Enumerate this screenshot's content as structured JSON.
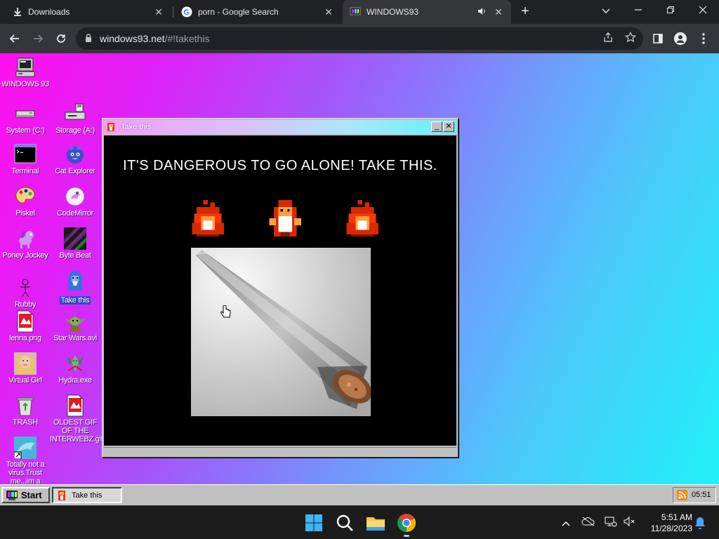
{
  "browser": {
    "tabs": [
      {
        "title": "Downloads",
        "icon": "download-icon",
        "active": false
      },
      {
        "title": "porn - Google Search",
        "icon": "google-icon",
        "active": false
      },
      {
        "title": "WINDOWS93",
        "icon": "windows93-icon",
        "active": true,
        "audio": true
      }
    ],
    "url_host": "windows93.net",
    "url_path": "/#!takethis"
  },
  "desktop": {
    "icons": [
      {
        "label": "WINDOWS 93",
        "icon": "computer-icon"
      },
      {
        "label": "System (C:)",
        "icon": "drive-icon"
      },
      {
        "label": "Storage (A:)",
        "icon": "floppy-drive-icon"
      },
      {
        "label": "Terminal",
        "icon": "terminal-icon"
      },
      {
        "label": "Cat Explorer",
        "icon": "cat-explorer-icon"
      },
      {
        "label": "Piskel",
        "icon": "paint-palette-icon"
      },
      {
        "label": "CodeMirror",
        "icon": "codemirror-icon"
      },
      {
        "label": "Poney Jockey",
        "icon": "pony-icon"
      },
      {
        "label": "Byte Beat",
        "icon": "bytebeat-icon"
      },
      {
        "label": "Rubby",
        "icon": "stick-figure-icon"
      },
      {
        "label": "Take this",
        "icon": "old-man-icon",
        "selected": true
      },
      {
        "label": "lenna.png",
        "icon": "image-file-icon"
      },
      {
        "label": "Star Wars.avi",
        "icon": "yoda-icon"
      },
      {
        "label": "Virtual Girl",
        "icon": "virtual-girl-icon"
      },
      {
        "label": "Hydra.exe",
        "icon": "hydra-icon"
      },
      {
        "label": "TRASH",
        "icon": "trash-icon"
      },
      {
        "label": "OLDEST GIF OF THE INTERWEBZ.gif",
        "icon": "gif-file-icon"
      },
      {
        "label": "Totally not a virus.Trust me...im a",
        "icon": "dolphin-shortcut-icon"
      }
    ]
  },
  "window": {
    "title": "Take this",
    "headline": "IT'S DANGEROUS TO GO ALONE! TAKE THIS.",
    "minimize": "_",
    "close": "✕"
  },
  "taskbar93": {
    "start_label": "Start",
    "task_label": "Take this",
    "clock": "05:51"
  },
  "taskbar": {
    "time": "5:51 AM",
    "date": "11/28/2023"
  },
  "colors": {
    "gradient_start": "#ff10ee",
    "gradient_end": "#1ef3f8",
    "selection": "#2a4fd6"
  }
}
